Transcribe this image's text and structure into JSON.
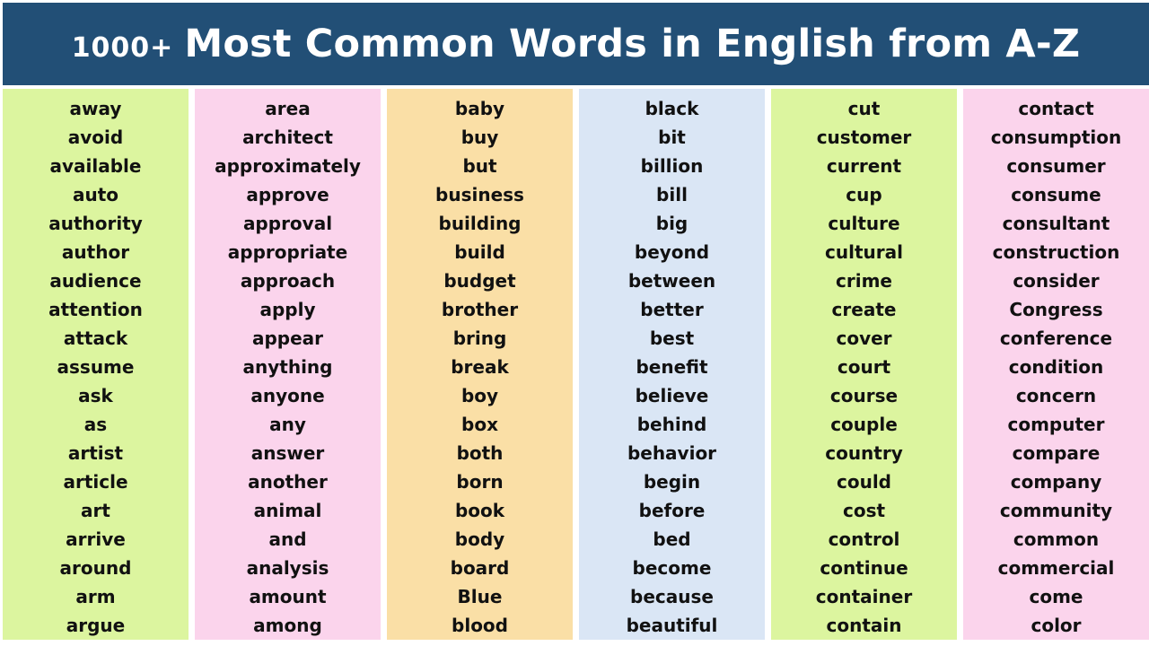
{
  "header": {
    "count_label": "1000+",
    "title": "Most Common Words in English from A-Z",
    "background_color": "#224f76",
    "text_color": "#ffffff"
  },
  "columns": [
    {
      "index": 1,
      "background_color": "#dcf59f",
      "words": [
        "away",
        "avoid",
        "available",
        "auto",
        "authority",
        "author",
        "audience",
        "attention",
        "attack",
        "assume",
        "ask",
        "as",
        "artist",
        "article",
        "art",
        "arrive",
        "around",
        "arm",
        "argue"
      ]
    },
    {
      "index": 2,
      "background_color": "#fbd4ec",
      "words": [
        "area",
        "architect",
        "approximately",
        "approve",
        "approval",
        "appropriate",
        "approach",
        "apply",
        "appear",
        "anything",
        "anyone",
        "any",
        "answer",
        "another",
        "animal",
        "and",
        "analysis",
        "amount",
        "among"
      ]
    },
    {
      "index": 3,
      "background_color": "#fadfa6",
      "words": [
        "baby",
        "buy",
        "but",
        "business",
        "building",
        "build",
        "budget",
        "brother",
        "bring",
        "break",
        "boy",
        "box",
        "both",
        "born",
        "book",
        "body",
        "board",
        "Blue",
        "blood"
      ]
    },
    {
      "index": 4,
      "background_color": "#dae6f5",
      "words": [
        "black",
        "bit",
        "billion",
        "bill",
        "big",
        "beyond",
        "between",
        "better",
        "best",
        "benefit",
        "believe",
        "behind",
        "behavior",
        "begin",
        "before",
        "bed",
        "become",
        "because",
        "beautiful"
      ]
    },
    {
      "index": 5,
      "background_color": "#dcf59f",
      "words": [
        "cut",
        "customer",
        "current",
        "cup",
        "culture",
        "cultural",
        "crime",
        "create",
        "cover",
        "court",
        "course",
        "couple",
        "country",
        "could",
        "cost",
        "control",
        "continue",
        "container",
        "contain"
      ]
    },
    {
      "index": 6,
      "background_color": "#fbd4ec",
      "words": [
        "contact",
        "consumption",
        "consumer",
        "consume",
        "consultant",
        "construction",
        "consider",
        "Congress",
        "conference",
        "condition",
        "concern",
        "computer",
        "compare",
        "company",
        "community",
        "common",
        "commercial",
        "come",
        "color"
      ]
    }
  ]
}
